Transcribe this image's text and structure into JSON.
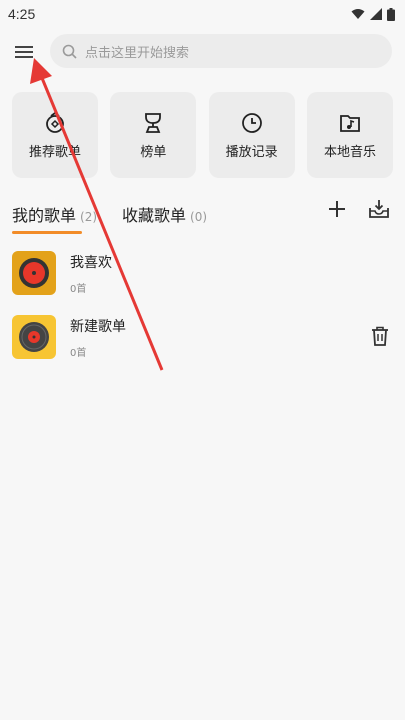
{
  "status_bar": {
    "time": "4:25"
  },
  "search": {
    "placeholder": "点击这里开始搜索"
  },
  "quick_actions": [
    {
      "label": "推荐歌单",
      "icon": "recommend-icon"
    },
    {
      "label": "榜单",
      "icon": "trophy-icon"
    },
    {
      "label": "播放记录",
      "icon": "clock-icon"
    },
    {
      "label": "本地音乐",
      "icon": "music-folder-icon"
    }
  ],
  "tabs": [
    {
      "label": "我的歌单",
      "count": "(2)",
      "active": true
    },
    {
      "label": "收藏歌单",
      "count": "(0)",
      "active": false
    }
  ],
  "playlists": [
    {
      "name": "我喜欢",
      "count": "0首"
    },
    {
      "name": "新建歌单",
      "count": "0首"
    }
  ],
  "colors": {
    "accent": "#f28c28",
    "cover_dark": "#e3a21a",
    "cover_light": "#f7c533",
    "record_red": "#e8372a",
    "annotation_arrow": "#e53935"
  }
}
